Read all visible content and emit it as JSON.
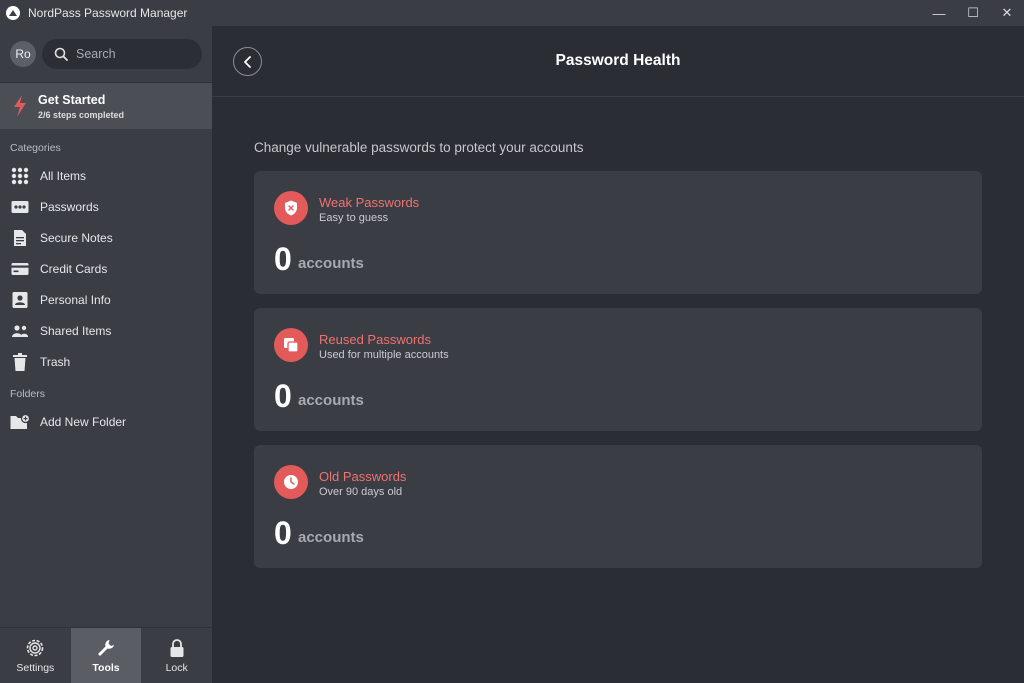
{
  "window": {
    "title": "NordPass Password Manager",
    "controls": {
      "minimize": "—",
      "maximize": "☐",
      "close": "✕"
    }
  },
  "sidebar": {
    "avatar_initials": "Ro",
    "search_placeholder": "Search",
    "get_started": {
      "title": "Get Started",
      "subtitle": "2/6 steps completed"
    },
    "categories_label": "Categories",
    "items": [
      {
        "label": "All Items",
        "icon": "grid-icon"
      },
      {
        "label": "Passwords",
        "icon": "password-icon"
      },
      {
        "label": "Secure Notes",
        "icon": "note-icon"
      },
      {
        "label": "Credit Cards",
        "icon": "credit-card-icon"
      },
      {
        "label": "Personal Info",
        "icon": "id-card-icon"
      },
      {
        "label": "Shared Items",
        "icon": "users-icon"
      },
      {
        "label": "Trash",
        "icon": "trash-icon"
      }
    ],
    "folders_label": "Folders",
    "add_folder": {
      "label": "Add New Folder",
      "icon": "folder-add-icon"
    },
    "bottom": [
      {
        "label": "Settings",
        "icon": "gear-icon",
        "active": false
      },
      {
        "label": "Tools",
        "icon": "wrench-icon",
        "active": true
      },
      {
        "label": "Lock",
        "icon": "lock-icon",
        "active": false
      }
    ]
  },
  "main": {
    "title": "Password Health",
    "subtitle": "Change vulnerable passwords to protect your accounts",
    "cards": [
      {
        "title": "Weak Passwords",
        "subtitle": "Easy to guess",
        "count": "0",
        "unit": "accounts",
        "icon": "weak-shield-icon"
      },
      {
        "title": "Reused Passwords",
        "subtitle": "Used for multiple accounts",
        "count": "0",
        "unit": "accounts",
        "icon": "duplicate-icon"
      },
      {
        "title": "Old Passwords",
        "subtitle": "Over 90 days old",
        "count": "0",
        "unit": "accounts",
        "icon": "clock-icon"
      }
    ]
  },
  "colors": {
    "accent_red": "#e25a5a",
    "title_red": "#f07272",
    "sidebar_bg": "#3a3d44",
    "main_bg": "#2a2d34",
    "card_bg": "#3a3d44"
  }
}
